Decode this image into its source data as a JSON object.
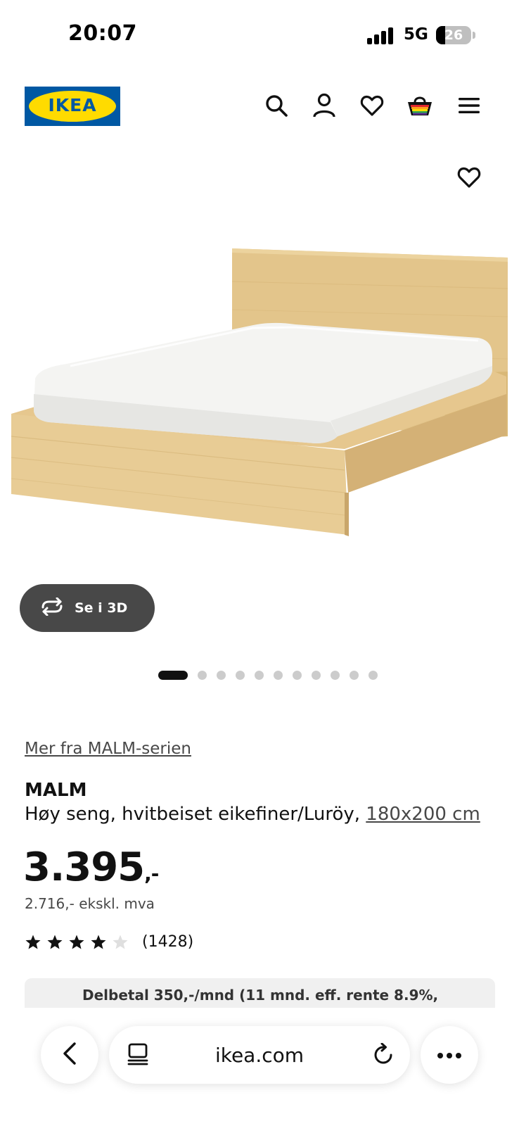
{
  "status_bar": {
    "time": "20:07",
    "network": "5G",
    "battery_level": "26"
  },
  "header": {
    "logo_text": "IKEA",
    "icons": [
      "search-icon",
      "account-icon",
      "favourites-icon",
      "basket-icon",
      "menu-icon"
    ]
  },
  "gallery": {
    "view_3d_label": "Se i 3D",
    "image_count": 11,
    "active_index": 0
  },
  "product": {
    "series_link": "Mer fra MALM-serien",
    "name": "MALM",
    "description": "Høy seng, hvitbeiset eikefiner/Luröy,",
    "size": "180x200 cm",
    "price": "3.395",
    "price_suffix": ",-",
    "price_ex_vat": "2.716,- ekskl. mva",
    "rating": 4,
    "rating_max": 5,
    "review_count": "(1428)",
    "finance_text": "Delbetal 350,-/mnd (11 mnd. eff. rente 8.9%,"
  },
  "browser": {
    "url": "ikea.com"
  },
  "colors": {
    "ikea_blue": "#0058a3",
    "ikea_yellow": "#ffdb00",
    "button_dark": "#484848"
  }
}
